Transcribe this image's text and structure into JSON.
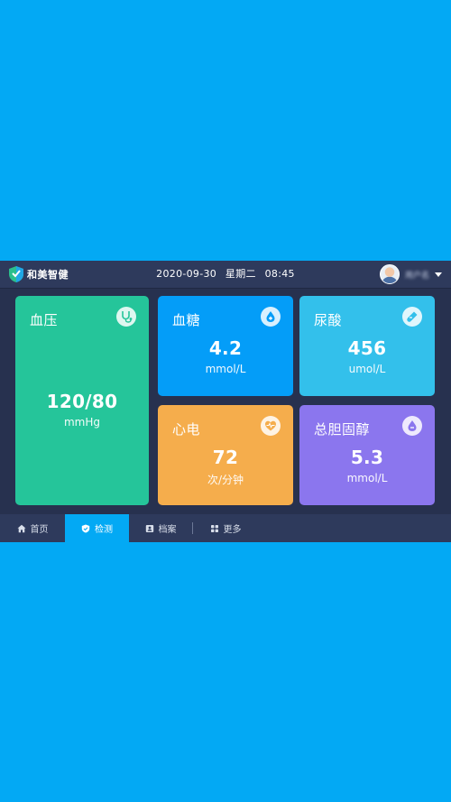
{
  "app": {
    "name": "和美智健"
  },
  "header": {
    "date": "2020-09-30",
    "weekday": "星期二",
    "time": "08:45",
    "user_name": "用户名"
  },
  "cards": {
    "blood_pressure": {
      "title": "血压",
      "value": "120/80",
      "unit": "mmHg",
      "icon": "stethoscope-icon"
    },
    "blood_glucose": {
      "title": "血糖",
      "value": "4.2",
      "unit": "mmol/L",
      "icon": "blood-drop-plus-icon"
    },
    "uric_acid": {
      "title": "尿酸",
      "value": "456",
      "unit": "umol/L",
      "icon": "test-tube-icon"
    },
    "ecg": {
      "title": "心电",
      "value": "72",
      "unit": "次/分钟",
      "icon": "heartbeat-icon"
    },
    "cholesterol": {
      "title": "总胆固醇",
      "value": "5.3",
      "unit": "mmol/L",
      "icon": "drop-icon"
    }
  },
  "nav": {
    "items": [
      {
        "label": "首页",
        "icon": "home-icon"
      },
      {
        "label": "检测",
        "icon": "shield-check-icon"
      },
      {
        "label": "档案",
        "icon": "profile-card-icon"
      },
      {
        "label": "更多",
        "icon": "grid-icon"
      }
    ],
    "active": "检测"
  },
  "colors": {
    "page_bg": "#03a9f4",
    "screen_bg": "#27314f",
    "blood_pressure": "#25c59a",
    "blood_glucose": "#049df8",
    "uric_acid": "#33c0eb",
    "ecg": "#f5ad4c",
    "cholesterol": "#8b76ee"
  }
}
